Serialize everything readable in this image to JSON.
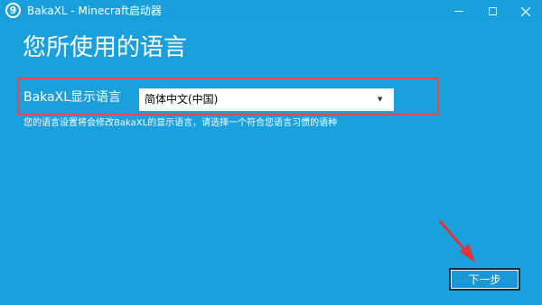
{
  "window": {
    "title": "BakaXL - Minecraft启动器",
    "app_icon_glyph": "9"
  },
  "page": {
    "title": "您所使用的语言"
  },
  "language": {
    "label": "BakaXL显示语言",
    "selected": "简体中文(中国)",
    "dropdown_arrow": "▼",
    "description": "您的语言设置将会修改BakaXL的显示语言，请选择一个符合您语言习惯的语种"
  },
  "footer": {
    "next_label": "下一步"
  },
  "colors": {
    "background": "#1aa0dc",
    "highlight": "#e5484a",
    "arrow": "#e0343a"
  }
}
